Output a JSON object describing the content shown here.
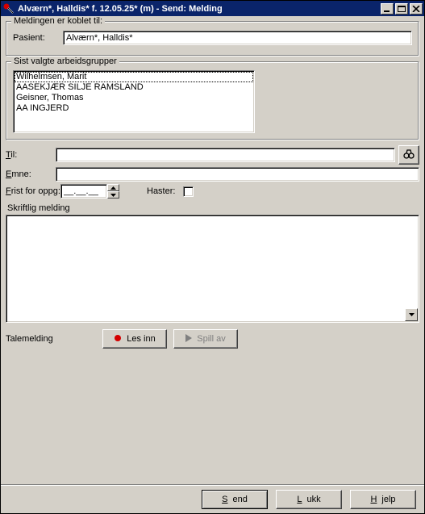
{
  "window": {
    "title": "Alværn*, Halldis* f. 12.05.25* (m) - Send: Melding"
  },
  "group_linked": {
    "legend": "Meldingen er koblet til:",
    "patient_label": "Pasient:",
    "patient_value": "Alværn*, Halldis*"
  },
  "group_workgroups": {
    "legend": "Sist valgte arbeidsgrupper",
    "items": [
      "Wilhelmsen, Marit",
      "AASEKJÆR SILJE RAMSLAND",
      "Geisner, Thomas",
      "AA INGJERD"
    ]
  },
  "fields": {
    "to_label": "Til:",
    "to_value": "",
    "subject_label": "Emne:",
    "subject_value": "",
    "deadline_label": "Frist for oppg:",
    "deadline_value": "__.__.__",
    "urgent_label": "Haster:"
  },
  "message": {
    "section_label": "Skriftlig melding",
    "value": ""
  },
  "voice": {
    "section_label": "Talemelding",
    "record_label": "Les inn",
    "play_label": "Spill av"
  },
  "buttons": {
    "send": "Send",
    "close": "Lukk",
    "help": "Hjelp"
  },
  "colors": {
    "face": "#d4d0c8",
    "titlebar": "#0a246a",
    "record_dot": "#d40000"
  }
}
